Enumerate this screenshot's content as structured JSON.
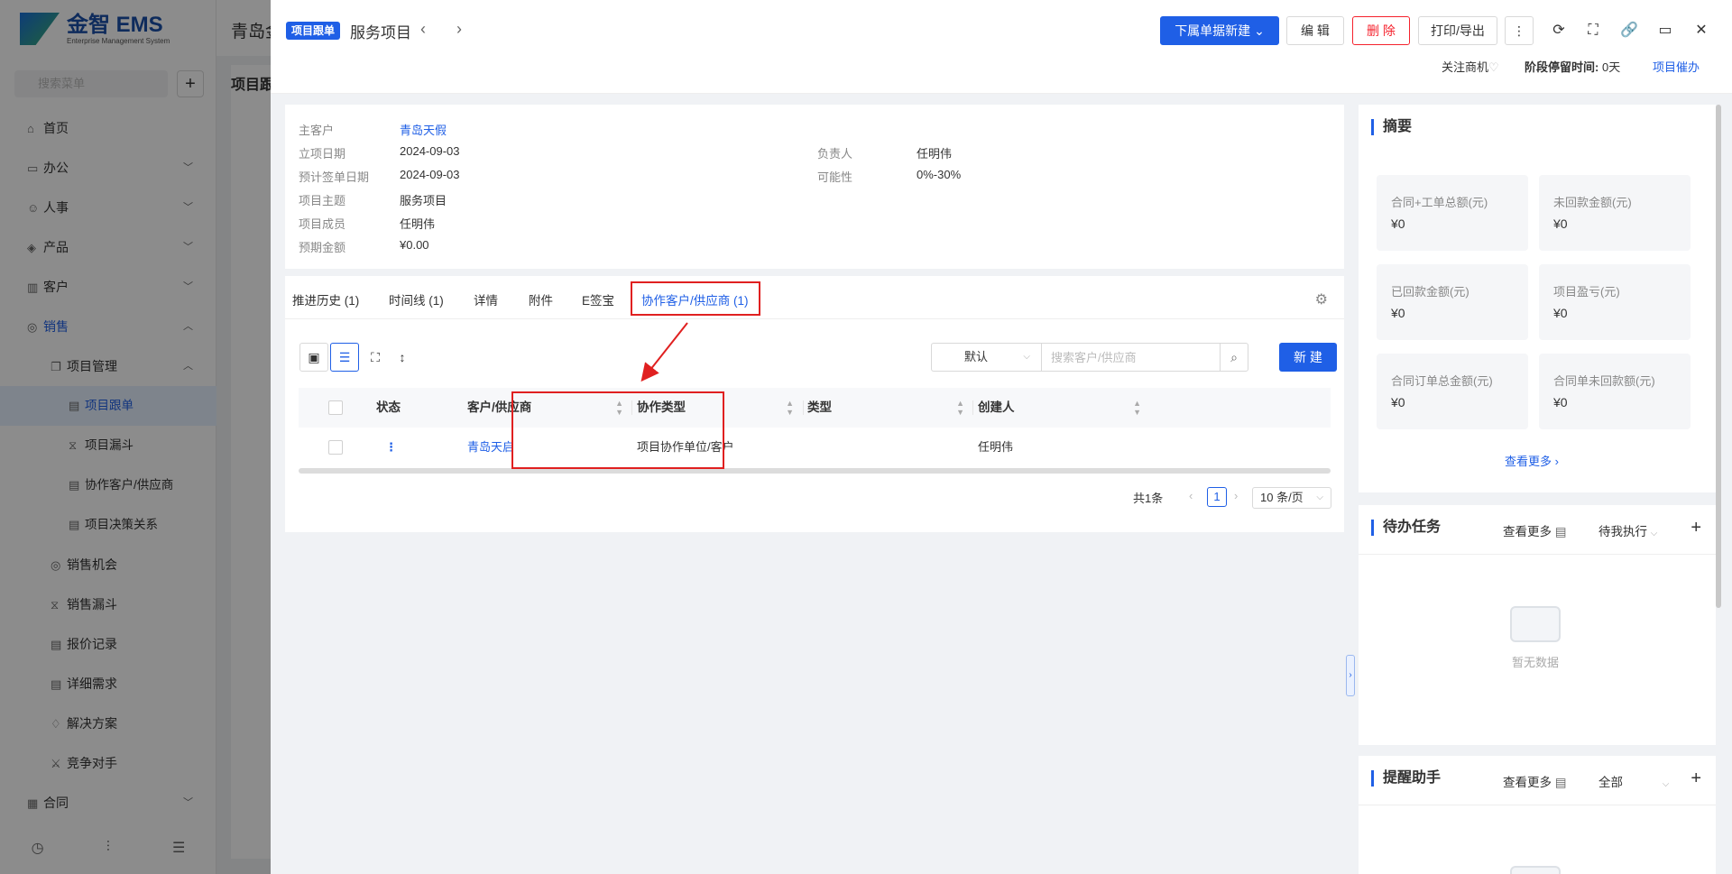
{
  "background": {
    "logo_text": "金智 EMS",
    "logo_sub": "Enterprise Management System",
    "search_placeholder": "搜索菜单",
    "page_header": "青岛金",
    "content_title": "项目跟",
    "menu": [
      {
        "label": "首页",
        "icon": "home-icon",
        "level": 0
      },
      {
        "label": "办公",
        "icon": "office-icon",
        "level": 0,
        "arrow": "⌄"
      },
      {
        "label": "人事",
        "icon": "people-icon",
        "level": 0,
        "arrow": "⌄"
      },
      {
        "label": "产品",
        "icon": "product-icon",
        "level": 0,
        "arrow": "⌄"
      },
      {
        "label": "客户",
        "icon": "customer-icon",
        "level": 0,
        "arrow": "⌄"
      },
      {
        "label": "销售",
        "icon": "sales-icon",
        "level": 0,
        "arrow": "⌃",
        "blue": true
      },
      {
        "label": "项目管理",
        "icon": "project-icon",
        "level": 1,
        "arrow": "⌃"
      },
      {
        "label": "项目跟单",
        "icon": "doc-icon",
        "level": 2,
        "active": true
      },
      {
        "label": "项目漏斗",
        "icon": "funnel-icon",
        "level": 2
      },
      {
        "label": "协作客户/供应商",
        "icon": "doc-icon",
        "level": 2
      },
      {
        "label": "项目决策关系",
        "icon": "doc-icon",
        "level": 2
      },
      {
        "label": "销售机会",
        "icon": "target-icon",
        "level": 1
      },
      {
        "label": "销售漏斗",
        "icon": "funnel-icon",
        "level": 1
      },
      {
        "label": "报价记录",
        "icon": "doc-icon",
        "level": 1
      },
      {
        "label": "详细需求",
        "icon": "doc-icon",
        "level": 1
      },
      {
        "label": "解决方案",
        "icon": "bulb-icon",
        "level": 1
      },
      {
        "label": "竞争对手",
        "icon": "vs-icon",
        "level": 1
      },
      {
        "label": "合同",
        "icon": "contract-icon",
        "level": 0,
        "arrow": "⌄"
      }
    ]
  },
  "header": {
    "badge": "项目跟单",
    "title": "服务项目",
    "btn_create_sub": "下属单据新建",
    "btn_edit": "编 辑",
    "btn_delete": "删 除",
    "btn_print": "打印/导出",
    "follow": "关注商机",
    "stage_label": "阶段停留时间:",
    "stage_value": "0天",
    "remind": "项目催办"
  },
  "info": {
    "main_customer_label": "主客户",
    "main_customer": "青岛天假",
    "start_date_label": "立项日期",
    "start_date": "2024-09-03",
    "sign_date_label": "预计签单日期",
    "sign_date": "2024-09-03",
    "subject_label": "项目主题",
    "subject": "服务项目",
    "members_label": "项目成员",
    "members": "任明伟",
    "amount_label": "预期金额",
    "amount": "¥0.00",
    "owner_label": "负责人",
    "owner": "任明伟",
    "possibility_label": "可能性",
    "possibility": "0%-30%"
  },
  "tabs": [
    "推进历史 (1)",
    "时间线 (1)",
    "详情",
    "附件",
    "E签宝",
    "协作客户/供应商 (1)"
  ],
  "toolbar": {
    "select_value": "默认",
    "search_placeholder": "搜索客户/供应商",
    "new_btn": "新 建"
  },
  "table": {
    "headers": [
      "状态",
      "客户/供应商",
      "协作类型",
      "类型",
      "创建人"
    ],
    "rows": [
      {
        "status": "⋮",
        "customer": "青岛天启",
        "coop_type": "项目协作单位/客户",
        "type": "",
        "creator": "任明伟"
      }
    ]
  },
  "pager": {
    "total": "共1条",
    "current": "1",
    "page_size": "10 条/页"
  },
  "summary": {
    "title": "摘要",
    "stats": [
      {
        "label": "合同+工单总额(元)",
        "value": "¥0"
      },
      {
        "label": "未回款金额(元)",
        "value": "¥0"
      },
      {
        "label": "已回款金额(元)",
        "value": "¥0"
      },
      {
        "label": "项目盈亏(元)",
        "value": "¥0"
      },
      {
        "label": "合同订单总金额(元)",
        "value": "¥0"
      },
      {
        "label": "合同单未回款额(元)",
        "value": "¥0"
      }
    ],
    "more": "查看更多"
  },
  "todo": {
    "title": "待办任务",
    "more": "查看更多",
    "filter": "待我执行",
    "empty": "暂无数据"
  },
  "reminder": {
    "title": "提醒助手",
    "more": "查看更多",
    "filter": "全部"
  }
}
